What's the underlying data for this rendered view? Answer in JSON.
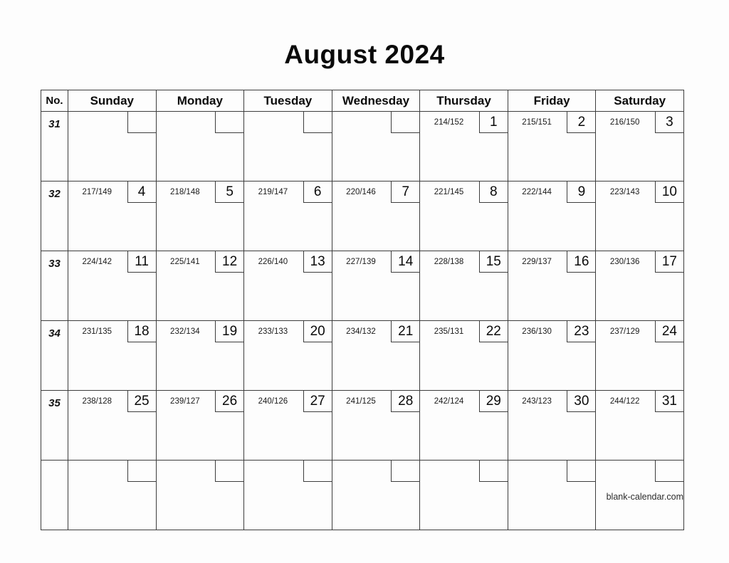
{
  "title": "August 2024",
  "footer": "blank-calendar.com",
  "header": {
    "week_column": "No.",
    "days": [
      "Sunday",
      "Monday",
      "Tuesday",
      "Wednesday",
      "Thursday",
      "Friday",
      "Saturday"
    ]
  },
  "weeks": [
    {
      "number": "31",
      "days": [
        {
          "doy": "",
          "day": ""
        },
        {
          "doy": "",
          "day": ""
        },
        {
          "doy": "",
          "day": ""
        },
        {
          "doy": "",
          "day": ""
        },
        {
          "doy": "214/152",
          "day": "1"
        },
        {
          "doy": "215/151",
          "day": "2"
        },
        {
          "doy": "216/150",
          "day": "3"
        }
      ]
    },
    {
      "number": "32",
      "days": [
        {
          "doy": "217/149",
          "day": "4"
        },
        {
          "doy": "218/148",
          "day": "5"
        },
        {
          "doy": "219/147",
          "day": "6"
        },
        {
          "doy": "220/146",
          "day": "7"
        },
        {
          "doy": "221/145",
          "day": "8"
        },
        {
          "doy": "222/144",
          "day": "9"
        },
        {
          "doy": "223/143",
          "day": "10"
        }
      ]
    },
    {
      "number": "33",
      "days": [
        {
          "doy": "224/142",
          "day": "11"
        },
        {
          "doy": "225/141",
          "day": "12"
        },
        {
          "doy": "226/140",
          "day": "13"
        },
        {
          "doy": "227/139",
          "day": "14"
        },
        {
          "doy": "228/138",
          "day": "15"
        },
        {
          "doy": "229/137",
          "day": "16"
        },
        {
          "doy": "230/136",
          "day": "17"
        }
      ]
    },
    {
      "number": "34",
      "days": [
        {
          "doy": "231/135",
          "day": "18"
        },
        {
          "doy": "232/134",
          "day": "19"
        },
        {
          "doy": "233/133",
          "day": "20"
        },
        {
          "doy": "234/132",
          "day": "21"
        },
        {
          "doy": "235/131",
          "day": "22"
        },
        {
          "doy": "236/130",
          "day": "23"
        },
        {
          "doy": "237/129",
          "day": "24"
        }
      ]
    },
    {
      "number": "35",
      "days": [
        {
          "doy": "238/128",
          "day": "25"
        },
        {
          "doy": "239/127",
          "day": "26"
        },
        {
          "doy": "240/126",
          "day": "27"
        },
        {
          "doy": "241/125",
          "day": "28"
        },
        {
          "doy": "242/124",
          "day": "29"
        },
        {
          "doy": "243/123",
          "day": "30"
        },
        {
          "doy": "244/122",
          "day": "31"
        }
      ]
    },
    {
      "number": "",
      "days": [
        {
          "doy": "",
          "day": ""
        },
        {
          "doy": "",
          "day": ""
        },
        {
          "doy": "",
          "day": ""
        },
        {
          "doy": "",
          "day": ""
        },
        {
          "doy": "",
          "day": ""
        },
        {
          "doy": "",
          "day": ""
        },
        {
          "doy": "",
          "day": ""
        }
      ]
    }
  ]
}
